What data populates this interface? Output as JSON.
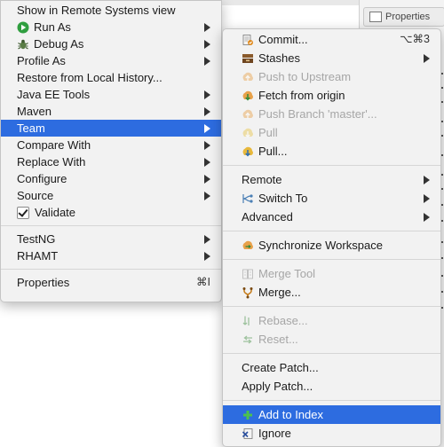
{
  "background": {
    "properties_tab_label": "Properties"
  },
  "main_menu": {
    "items": [
      {
        "label": "Show in Remote Systems view",
        "icon": null,
        "submenu": false
      },
      {
        "label": "Run As",
        "icon": "run-icon",
        "submenu": true
      },
      {
        "label": "Debug As",
        "icon": "debug-bug-icon",
        "submenu": true
      },
      {
        "label": "Profile As",
        "icon": null,
        "submenu": true
      },
      {
        "label": "Restore from Local History...",
        "icon": null,
        "submenu": false
      },
      {
        "label": "Java EE Tools",
        "icon": null,
        "submenu": true
      },
      {
        "label": "Maven",
        "icon": null,
        "submenu": true
      },
      {
        "label": "Team",
        "icon": null,
        "submenu": true,
        "selected": true
      },
      {
        "label": "Compare With",
        "icon": null,
        "submenu": true
      },
      {
        "label": "Replace With",
        "icon": null,
        "submenu": true
      },
      {
        "label": "Configure",
        "icon": null,
        "submenu": true
      },
      {
        "label": "Source",
        "icon": null,
        "submenu": true
      },
      {
        "label": "Validate",
        "icon": "checkbox-checked",
        "submenu": false
      },
      {
        "label": "TestNG",
        "icon": null,
        "submenu": true
      },
      {
        "label": "RHAMT",
        "icon": null,
        "submenu": true
      },
      {
        "label": "Properties",
        "shortcut": "⌘I",
        "submenu": false
      }
    ]
  },
  "team_menu": {
    "items": [
      {
        "label": "Commit...",
        "icon": "commit-icon",
        "shortcut": "⌥⌘3",
        "enabled": true
      },
      {
        "label": "Stashes",
        "icon": "stash-icon",
        "submenu": true,
        "enabled": true
      },
      {
        "label": "Push to Upstream",
        "icon": "push-icon",
        "enabled": false
      },
      {
        "label": "Fetch from origin",
        "icon": "fetch-icon",
        "enabled": true
      },
      {
        "label": "Push Branch 'master'...",
        "icon": "push-branch-icon",
        "enabled": false
      },
      {
        "label": "Pull",
        "icon": "pull-icon",
        "enabled": false
      },
      {
        "label": "Pull...",
        "icon": "pull-dialog-icon",
        "enabled": true
      },
      {
        "label": "Remote",
        "submenu": true,
        "enabled": true
      },
      {
        "label": "Switch To",
        "icon": "switch-branch-icon",
        "submenu": true,
        "enabled": true
      },
      {
        "label": "Advanced",
        "submenu": true,
        "enabled": true
      },
      {
        "label": "Synchronize Workspace",
        "icon": "synchronize-icon",
        "enabled": true
      },
      {
        "label": "Merge Tool",
        "icon": "merge-tool-icon",
        "enabled": false
      },
      {
        "label": "Merge...",
        "icon": "merge-icon",
        "enabled": true
      },
      {
        "label": "Rebase...",
        "icon": "rebase-icon",
        "enabled": false
      },
      {
        "label": "Reset...",
        "icon": "reset-icon",
        "enabled": false
      },
      {
        "label": "Create Patch...",
        "enabled": true
      },
      {
        "label": "Apply Patch...",
        "enabled": true
      },
      {
        "label": "Add to Index",
        "icon": "add-plus-icon",
        "enabled": true,
        "selected": true
      },
      {
        "label": "Ignore",
        "icon": "ignore-icon",
        "enabled": true
      }
    ]
  },
  "colors": {
    "selection": "#2d6ce0",
    "disabled_text": "#a6a6a6",
    "menu_bg": "#f2f2f2"
  }
}
